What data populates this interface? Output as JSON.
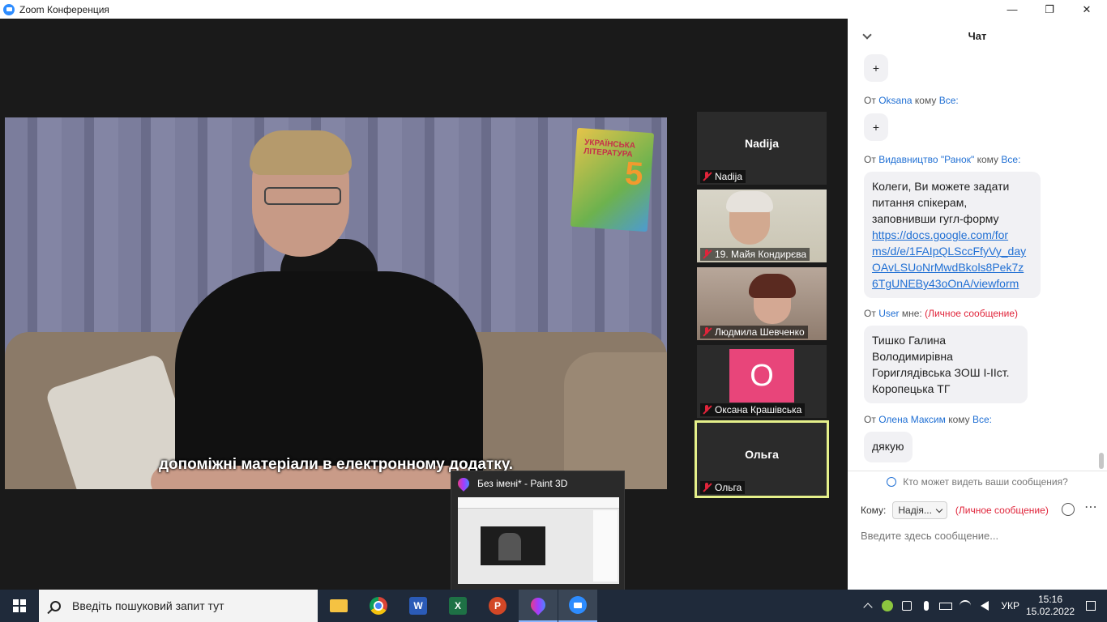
{
  "window": {
    "title": "Zoom Конференция"
  },
  "video": {
    "subtitle": "допоміжні матеріали в електронному додатку.",
    "book_title": "УКРАЇНСЬКА ЛІТЕРАТУРА",
    "book_number": "5"
  },
  "participants": [
    {
      "name": "Nadija",
      "display": "Nadija",
      "muted": true
    },
    {
      "name": "19. Майя Кондирєва",
      "muted": true
    },
    {
      "name": "Людмила Шевченко",
      "muted": true
    },
    {
      "name": "Оксана Крашівська",
      "avatar_letter": "О",
      "avatar_color": "#e8457a",
      "muted": true
    },
    {
      "name": "Ольга",
      "display": "Ольга",
      "muted": true,
      "active": true
    }
  ],
  "preview": {
    "title": "Без імені* - Paint 3D"
  },
  "chat": {
    "title": "Чат",
    "messages": [
      {
        "text": "+"
      },
      {
        "from_prefix": "От",
        "from": "Oksana",
        "to_word": "кому",
        "to": "Все:",
        "text": "+"
      },
      {
        "from_prefix": "От",
        "from": "Видавництво \"Ранок\"",
        "to_word": "кому",
        "to": "Все:",
        "lines": [
          "Колеги, Ви можете задати",
          "питання спікерам,",
          "заповнивши гугл-форму"
        ],
        "link_lines": [
          "https://docs.google.com/for",
          "ms/d/e/1FAIpQLSccFfyVy_day",
          "OAvLSUoNrMwdBkols8Pek7z",
          "6TgUNEBy43oOnA/viewform"
        ]
      },
      {
        "from_prefix": "От",
        "from": "User",
        "to_word": "мне:",
        "private": "(Личное сообщение)",
        "lines": [
          "Тишко Галина",
          "Володимирівна",
          "Гориглядівська ЗОШ І-ІІст.",
          "Коропецька ТГ"
        ]
      },
      {
        "from_prefix": "От",
        "from": "Олена Максим",
        "to_word": "кому",
        "to": "Все:",
        "text": "дякую"
      }
    ],
    "who_can_see": "Кто может видеть ваши сообщения?",
    "to_label": "Кому:",
    "to_value": "Надія...",
    "to_private": "(Личное сообщение)",
    "input_placeholder": "Введите здесь сообщение..."
  },
  "taskbar": {
    "search_placeholder": "Введіть пошуковий запит тут",
    "lang": "УКР",
    "time": "15:16",
    "date": "15.02.2022"
  }
}
